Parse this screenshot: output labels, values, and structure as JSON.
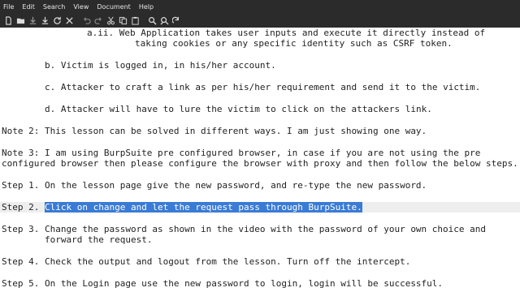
{
  "menu": [
    "File",
    "Edit",
    "Search",
    "View",
    "Document",
    "Help"
  ],
  "toolbar": {
    "icons": [
      "new-file-icon",
      "open-file-icon",
      "save-icon",
      "save-as-icon",
      "reload-icon",
      "close-icon",
      "undo-icon",
      "redo-icon",
      "cut-icon",
      "copy-icon",
      "paste-icon",
      "find-icon",
      "find-replace-icon",
      "goto-icon"
    ]
  },
  "document": {
    "line_a_ii_1": "a.ii. Web Application takes user inputs and execute it directly instead of",
    "line_a_ii_2": "taking cookies or any specific identity such as CSRF token.",
    "line_b": "b. Victim is logged in, in his/her account.",
    "line_c": "c. Attacker to craft a link as per his/her requirement and send it to the victim.",
    "line_d": "d. Attacker will have to lure the victim to click on the attackers link.",
    "note2": "Note 2: This lesson can be solved in different ways. I am just showing one way.",
    "note3_1": "Note 3: I am using BurpSuite pre configured browser, in case if you are not using the pre",
    "note3_2": "configured browser then please configure the browser with proxy and then follow the below steps.",
    "step1": "Step 1. On the lesson page give the new password, and re-type the new password.",
    "step2_prefix": "Step 2. ",
    "step2_selected": "Click on change and let the request pass through BurpSuite.",
    "step3_1": "Step 3. Change the password as shown in the video with the password of your own choice and",
    "step3_2": "forward the request.",
    "step4": "Step 4. Check the output and logout from the lesson. Turn off the intercept.",
    "step5": "Step 5. On the Login page use the new password to login, login will be successful."
  },
  "colors": {
    "menubar_bg": "#2b2b2b",
    "selection": "#3a7bd5",
    "current_line": "#eeeeee"
  }
}
